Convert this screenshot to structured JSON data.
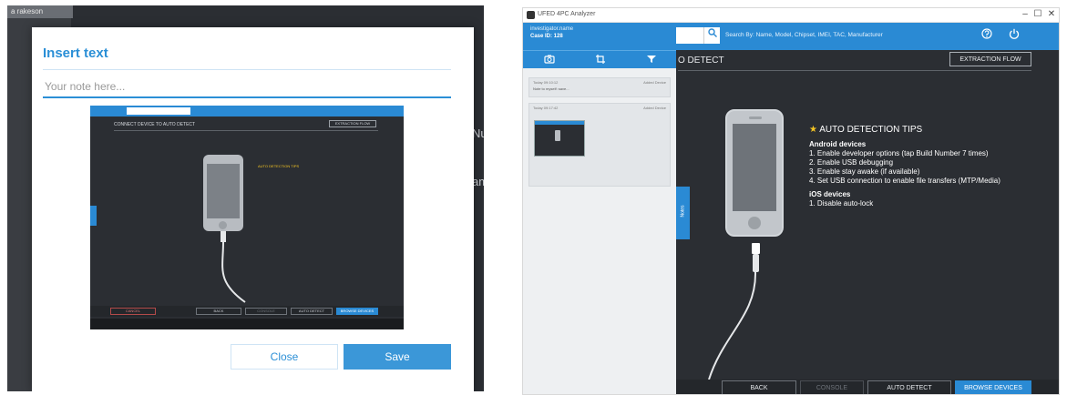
{
  "left_screen": {
    "background_tab": "a rakeson",
    "peek_right": [
      "Nu",
      "am"
    ],
    "modal": {
      "title": "Insert text",
      "placeholder": "Your note here...",
      "close_label": "Close",
      "save_label": "Save"
    },
    "screenshot_preview": {
      "title": "CONNECT DEVICE TO AUTO DETECT",
      "flow_label": "EXTRACTION FLOW",
      "tips_title": "AUTO DETECTION TIPS",
      "footer_buttons": [
        "CANCEL",
        "BACK",
        "CONSOLE",
        "AUTO DETECT",
        "BROWSE DEVICES"
      ]
    }
  },
  "right_screen": {
    "titlebar": {
      "title": "UFED 4PC Analyzer",
      "controls": [
        "–",
        "☐",
        "✕"
      ]
    },
    "sidebar": {
      "user": "investigator.name",
      "case": "Case ID: 128",
      "tabs": [
        "camera-icon",
        "crop-icon",
        "filter-icon"
      ],
      "notes": [
        {
          "left": "Today  09:10:12",
          "right": "Added Device",
          "text": "Note to myself: save..."
        },
        {
          "left": "Today  09:17:42",
          "right": "Added Device",
          "text": ""
        }
      ],
      "notes_tab_label": "Notes"
    },
    "topbar": {
      "search_hint": "Search By: Name, Model, Chipset, IMEI, TAC, Manufacturer",
      "icons": [
        "help-icon",
        "power-icon"
      ]
    },
    "main": {
      "title": "O DETECT",
      "flow_button": "EXTRACTION FLOW",
      "tips": {
        "title": "AUTO DETECTION TIPS",
        "android_header": "Android devices",
        "android_items": [
          "1. Enable developer options (tap Build Number 7 times)",
          "2. Enable USB debugging",
          "3. Enable stay awake (if available)",
          "4. Set USB connection to enable file transfers (MTP/Media)"
        ],
        "ios_header": "iOS devices",
        "ios_items": [
          "1. Disable auto-lock"
        ]
      }
    },
    "footer": {
      "back": "BACK",
      "console": "CONSOLE",
      "auto_detect": "AUTO DETECT",
      "browse": "BROWSE DEVICES"
    }
  },
  "colors": {
    "accent": "#2a8ad4",
    "dark_bg": "#2b2e33",
    "star": "#f5c523"
  }
}
